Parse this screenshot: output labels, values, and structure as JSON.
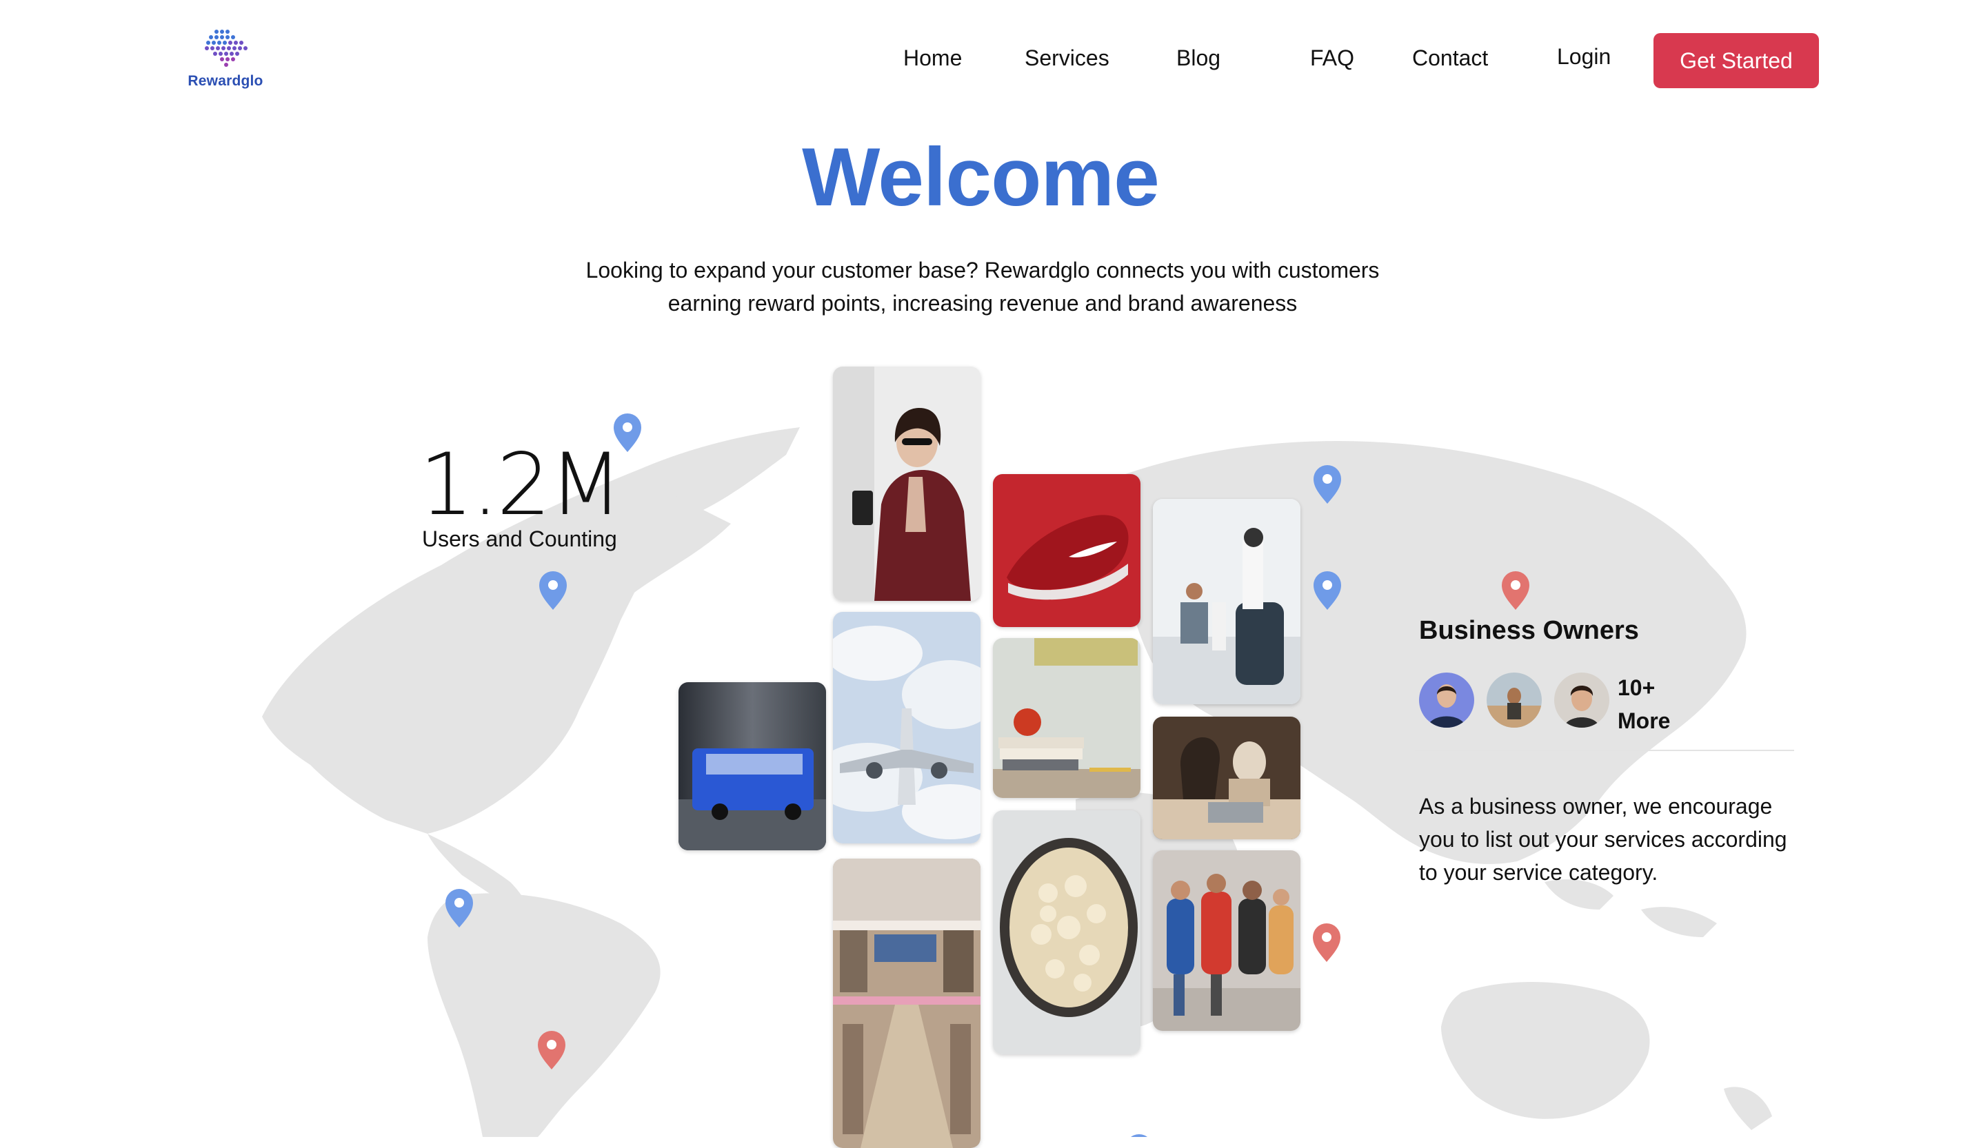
{
  "brand": {
    "name": "Rewardglo"
  },
  "nav": {
    "items": [
      {
        "label": "Home"
      },
      {
        "label": "Services"
      },
      {
        "label": "Blog"
      },
      {
        "label": "FAQ"
      },
      {
        "label": "Contact"
      },
      {
        "label": "Login"
      }
    ],
    "cta_label": "Get Started"
  },
  "hero": {
    "title": "Welcome",
    "subtitle_line1": "Looking to expand your customer base? Rewardglo connects you with customers",
    "subtitle_line2": "earning reward points, increasing revenue and brand awareness"
  },
  "stats": {
    "value": "1.2M",
    "label": "Users and Counting"
  },
  "business": {
    "title": "Business Owners",
    "more_line1": "10+",
    "more_line2": "More",
    "description": "As a business owner, we encourage you to list out your services according to your service category."
  },
  "colors": {
    "accent": "#3b6fcf",
    "cta": "#d8394f",
    "pin_blue": "#6f9be8",
    "pin_red": "#e2746f",
    "map": "#e4e4e4"
  }
}
